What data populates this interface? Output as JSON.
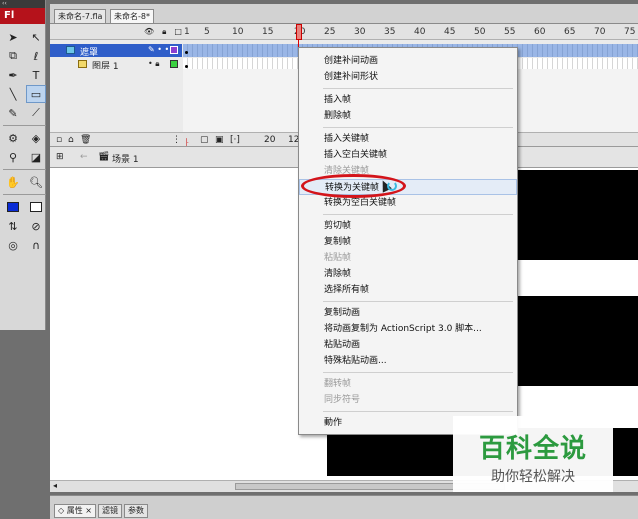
{
  "tools": {
    "topbar_label": "‹‹",
    "logo": "Fl"
  },
  "document_tabs": [
    "未命名-7.fla",
    "未命名-8*"
  ],
  "timeline": {
    "frame_numbers": [
      "1",
      "5",
      "10",
      "15",
      "20",
      "25",
      "30",
      "35",
      "40",
      "45",
      "50",
      "55",
      "60",
      "65",
      "70",
      "75"
    ],
    "current_frame": "20",
    "layers": [
      {
        "name": "遮罩",
        "selected": true
      },
      {
        "name": "图层 1",
        "selected": false
      }
    ],
    "footer": {
      "frame": "20",
      "fps": "12"
    }
  },
  "scene": {
    "label": "场景 1"
  },
  "context_menu": {
    "items": [
      {
        "label": "创建补间动画",
        "disabled": false
      },
      {
        "label": "创建补间形状",
        "disabled": false
      },
      {
        "sep": true
      },
      {
        "label": "插入帧",
        "disabled": false
      },
      {
        "label": "删除帧",
        "disabled": false
      },
      {
        "sep": true
      },
      {
        "label": "插入关键帧",
        "disabled": false
      },
      {
        "label": "插入空白关键帧",
        "disabled": false
      },
      {
        "label": "清除关键帧",
        "disabled": true
      },
      {
        "label": "转换为关键帧",
        "disabled": false,
        "highlighted": true
      },
      {
        "label": "转换为空白关键帧",
        "disabled": false
      },
      {
        "sep": true
      },
      {
        "label": "剪切帧",
        "disabled": false
      },
      {
        "label": "复制帧",
        "disabled": false
      },
      {
        "label": "粘贴帧",
        "disabled": true
      },
      {
        "label": "清除帧",
        "disabled": false
      },
      {
        "label": "选择所有帧",
        "disabled": false
      },
      {
        "sep": true
      },
      {
        "label": "复制动画",
        "disabled": false
      },
      {
        "label": "将动画复制为 ActionScript 3.0 脚本...",
        "disabled": false
      },
      {
        "label": "粘贴动画",
        "disabled": false
      },
      {
        "label": "特殊粘贴动画...",
        "disabled": false
      },
      {
        "sep": true
      },
      {
        "label": "翻转帧",
        "disabled": true
      },
      {
        "label": "同步符号",
        "disabled": true
      },
      {
        "sep": true
      },
      {
        "label": "動作",
        "disabled": false
      }
    ]
  },
  "bottom_tabs": [
    "◇ 属性 ×",
    "滤镜",
    "参数"
  ],
  "watermark": {
    "title": "百科全说",
    "subtitle": "助你轻松解决"
  },
  "colors": {
    "highlight_oval": "#d3141a",
    "layer_selected": "#2f5ec9",
    "watermark_green": "#2c9a3f"
  }
}
